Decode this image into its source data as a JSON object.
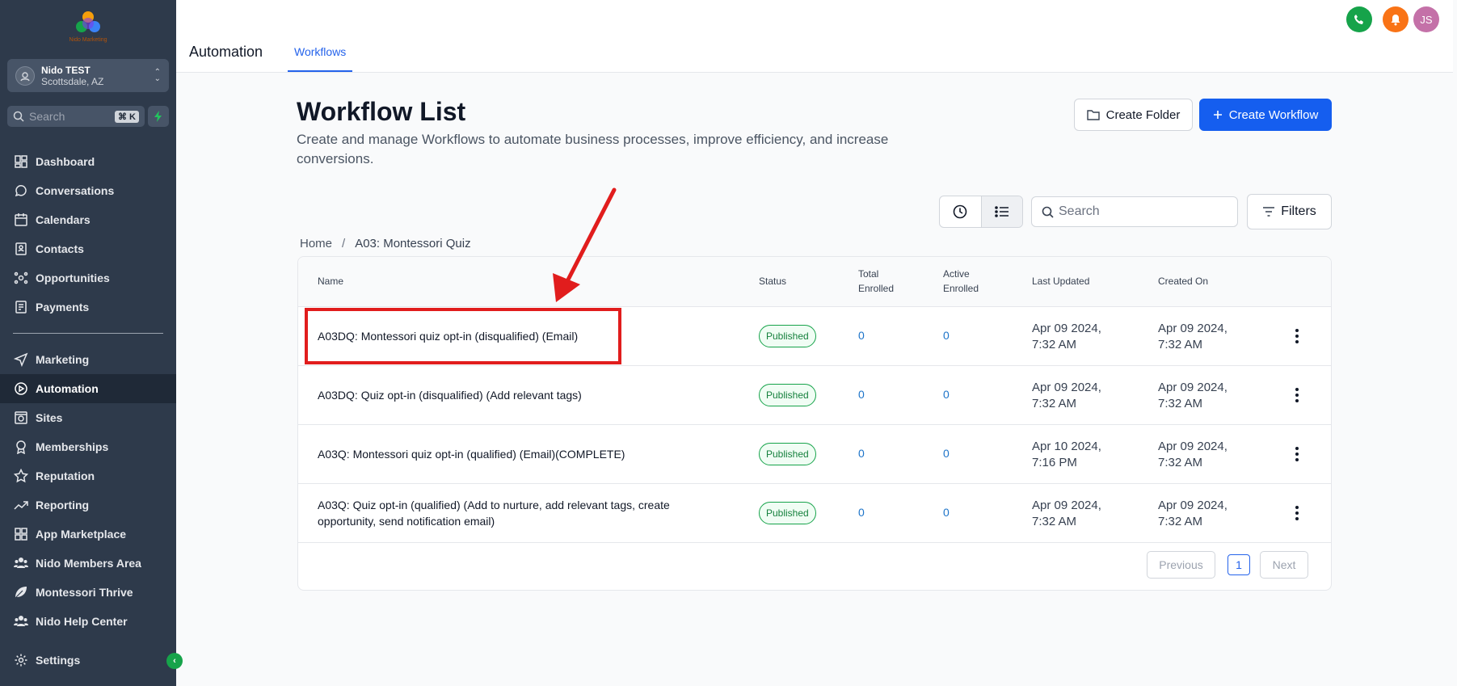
{
  "sidebar": {
    "logo_text": "Nido Marketing",
    "account": {
      "name": "Nido TEST",
      "location": "Scottsdale, AZ"
    },
    "search": {
      "placeholder": "Search",
      "shortcut": "⌘ K"
    },
    "items_top": [
      {
        "label": "Dashboard",
        "icon": "dashboard-icon"
      },
      {
        "label": "Conversations",
        "icon": "chat-icon"
      },
      {
        "label": "Calendars",
        "icon": "calendar-icon"
      },
      {
        "label": "Contacts",
        "icon": "contacts-icon"
      },
      {
        "label": "Opportunities",
        "icon": "opportunities-icon"
      },
      {
        "label": "Payments",
        "icon": "payments-icon"
      }
    ],
    "items_main": [
      {
        "label": "Marketing",
        "icon": "send-icon"
      },
      {
        "label": "Automation",
        "icon": "automation-icon",
        "active": true
      },
      {
        "label": "Sites",
        "icon": "sites-icon"
      },
      {
        "label": "Memberships",
        "icon": "memberships-icon"
      },
      {
        "label": "Reputation",
        "icon": "star-icon"
      },
      {
        "label": "Reporting",
        "icon": "trend-icon"
      },
      {
        "label": "App Marketplace",
        "icon": "grid-icon"
      },
      {
        "label": "Nido Members Area",
        "icon": "users-icon"
      },
      {
        "label": "Montessori Thrive",
        "icon": "leaf-icon"
      },
      {
        "label": "Nido Help Center",
        "icon": "users-icon"
      }
    ],
    "settings_label": "Settings"
  },
  "topbar": {
    "title": "Automation",
    "tab": "Workflows",
    "avatar_initials": "JS",
    "colors": {
      "phone": "#16a34a",
      "bell": "#f97316",
      "avatar": "#c471a8"
    }
  },
  "main": {
    "title": "Workflow List",
    "subtitle": "Create and manage Workflows to automate business processes, improve efficiency, and increase conversions.",
    "create_folder_label": "Create Folder",
    "create_workflow_label": "Create Workflow",
    "search_placeholder": "Search",
    "filters_label": "Filters",
    "breadcrumb": {
      "home": "Home",
      "separator": "/",
      "current": "A03: Montessori Quiz"
    }
  },
  "table": {
    "headers": {
      "name": "Name",
      "status": "Status",
      "total_1": "Total",
      "total_2": "Enrolled",
      "active_1": "Active",
      "active_2": "Enrolled",
      "updated": "Last Updated",
      "created": "Created On"
    },
    "rows": [
      {
        "name": "A03DQ: Montessori quiz opt-in (disqualified) (Email)",
        "status": "Published",
        "total": "0",
        "active": "0",
        "updated_1": "Apr 09 2024,",
        "updated_2": "7:32 AM",
        "created_1": "Apr 09 2024,",
        "created_2": "7:32 AM"
      },
      {
        "name": "A03DQ: Quiz opt-in (disqualified) (Add relevant tags)",
        "status": "Published",
        "total": "0",
        "active": "0",
        "updated_1": "Apr 09 2024,",
        "updated_2": "7:32 AM",
        "created_1": "Apr 09 2024,",
        "created_2": "7:32 AM"
      },
      {
        "name": "A03Q: Montessori quiz opt-in (qualified) (Email)(COMPLETE)",
        "status": "Published",
        "total": "0",
        "active": "0",
        "updated_1": "Apr 10 2024,",
        "updated_2": "7:16 PM",
        "created_1": "Apr 09 2024,",
        "created_2": "7:32 AM"
      },
      {
        "name": "A03Q: Quiz opt-in (qualified) (Add to nurture, add relevant tags, create opportunity, send notification email)",
        "status": "Published",
        "total": "0",
        "active": "0",
        "updated_1": "Apr 09 2024,",
        "updated_2": "7:32 AM",
        "created_1": "Apr 09 2024,",
        "created_2": "7:32 AM"
      }
    ],
    "pagination": {
      "previous": "Previous",
      "page": "1",
      "next": "Next"
    }
  },
  "annotation": {
    "highlight_color": "#e11d1d",
    "arrow_color": "#e11d1d"
  }
}
